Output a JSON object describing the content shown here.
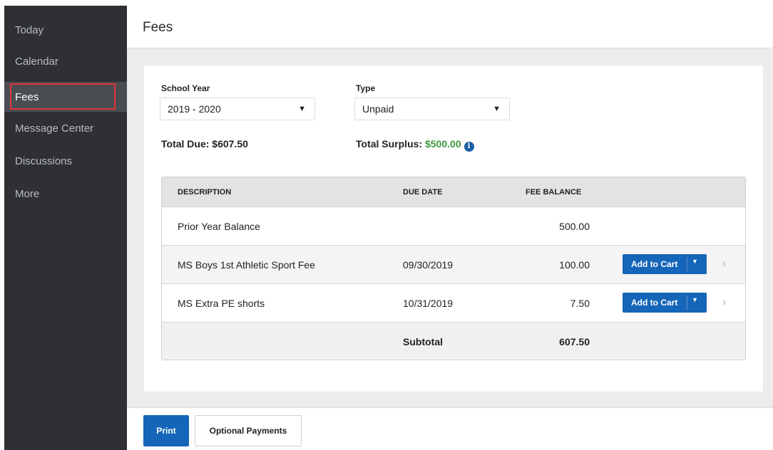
{
  "sidebar": {
    "items": [
      {
        "label": "Today"
      },
      {
        "label": "Calendar"
      },
      {
        "label": "Fees"
      },
      {
        "label": "Message Center"
      },
      {
        "label": "Discussions"
      },
      {
        "label": "More"
      }
    ],
    "active": "Fees"
  },
  "header": {
    "title": "Fees"
  },
  "filters": {
    "school_year_label": "School Year",
    "school_year_value": "2019 - 2020",
    "type_label": "Type",
    "type_value": "Unpaid"
  },
  "totals": {
    "due": "Total Due: $607.50",
    "surplus_label": "Total Surplus:",
    "surplus_value": "$500.00",
    "info_icon": "info-circle-icon",
    "surplus_color": "#3c9a3c"
  },
  "table": {
    "columns": [
      "DESCRIPTION",
      "DUE DATE",
      "FEE BALANCE"
    ],
    "rows": [
      {
        "description": "Prior Year Balance",
        "due_date": "",
        "balance": "500.00"
      },
      {
        "description": "MS Boys 1st Athletic Sport Fee",
        "due_date": "09/30/2019",
        "balance": "100.00",
        "action": "Add to Cart"
      },
      {
        "description": "MS Extra PE shorts",
        "due_date": "10/31/2019",
        "balance": "7.50",
        "action": "Add to Cart"
      }
    ],
    "subtotal_label": "Subtotal",
    "subtotal_value": "607.50"
  },
  "footer": {
    "print_label": "Print",
    "optional_payments_label": "Optional Payments"
  },
  "colors": {
    "sidebar_bg": "#2e3033",
    "accent_blue": "#1565b8",
    "highlight_red": "#e0353b"
  }
}
